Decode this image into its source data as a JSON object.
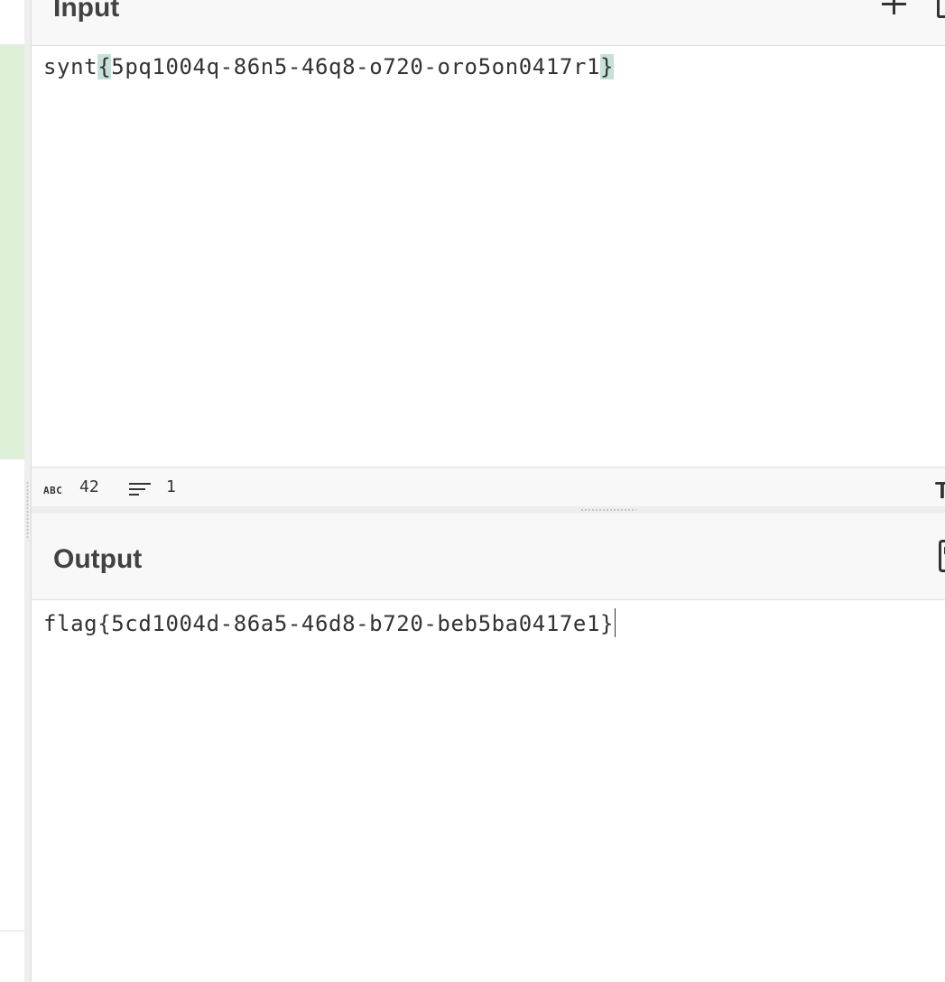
{
  "input": {
    "title": "Input",
    "text_prefix": "synt",
    "open_brace": "{",
    "text_body": "5pq1004q-86n5-46q8-o720-oro5on0417r1",
    "close_brace": "}"
  },
  "status": {
    "length_label": "ABC",
    "length_value": "42",
    "lines_value": "1"
  },
  "output": {
    "title": "Output",
    "text": "flag{5cd1004d-86a5-46d8-b720-beb5ba0417e1}"
  },
  "icons": {
    "add": "plus-icon",
    "input_action": "clipped-icon",
    "length": "abc-icon",
    "lines": "lines-icon",
    "font": "text-icon",
    "save": "save-icon"
  },
  "colors": {
    "recipe_highlight": "#dff0d8",
    "bracket_highlight": "#c6e0da",
    "header_bg": "#f8f8f8",
    "border": "#dddddd"
  }
}
